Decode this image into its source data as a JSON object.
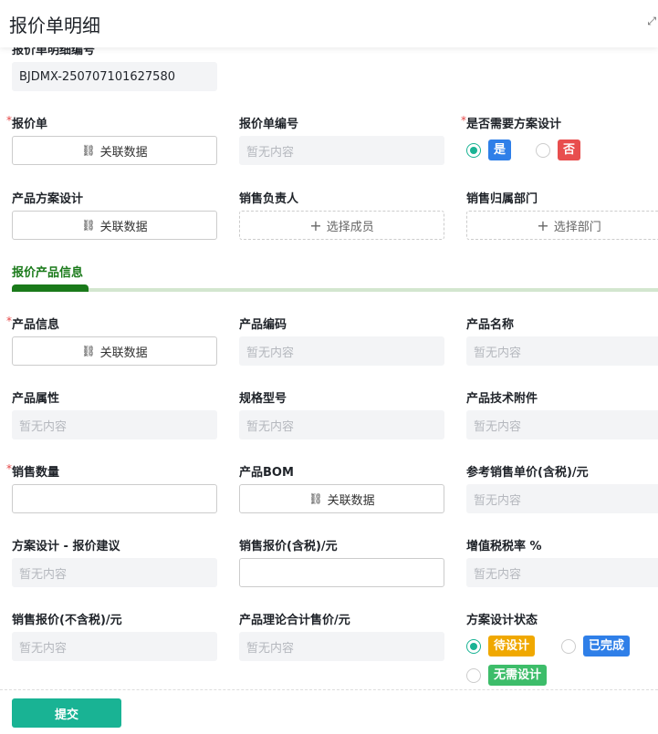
{
  "header": {
    "title": "报价单明细",
    "expand_icon": "expand-icon"
  },
  "detail_no": {
    "label": "报价单明细编号",
    "value": "BJDMX-250707101627580"
  },
  "placeholders": {
    "empty": "暂无内容",
    "link": "关联数据",
    "member": "选择成员",
    "dept": "选择部门"
  },
  "section_title": "报价产品信息",
  "fields": [
    {
      "label": "报价单",
      "required": true,
      "kind": "link"
    },
    {
      "label": "报价单编号",
      "kind": "ro"
    },
    {
      "label": "是否需要方案设计",
      "required": true,
      "kind": "radio"
    },
    {
      "label": "产品方案设计",
      "kind": "link"
    },
    {
      "label": "销售负责人",
      "kind": "member"
    },
    {
      "label": "销售归属部门",
      "kind": "dept"
    },
    {
      "label": "产品信息",
      "required": true,
      "kind": "link"
    },
    {
      "label": "产品编码",
      "kind": "ro"
    },
    {
      "label": "产品名称",
      "kind": "ro"
    },
    {
      "label": "产品属性",
      "kind": "ro"
    },
    {
      "label": "规格型号",
      "kind": "ro"
    },
    {
      "label": "产品技术附件",
      "kind": "ro"
    },
    {
      "label": "销售数量",
      "required": true,
      "kind": "input"
    },
    {
      "label": "产品BOM",
      "kind": "link"
    },
    {
      "label": "参考销售单价(含税)/元",
      "kind": "ro"
    },
    {
      "label": "方案设计 - 报价建议",
      "kind": "ro"
    },
    {
      "label": "销售报价(含税)/元",
      "kind": "input"
    },
    {
      "label": "增值税税率 %",
      "kind": "ro"
    },
    {
      "label": "销售报价(不含税)/元",
      "kind": "ro"
    },
    {
      "label": "产品理论合计售价/元",
      "kind": "ro"
    },
    {
      "label": "方案设计状态",
      "kind": "radio2"
    }
  ],
  "need_design_options": [
    {
      "label": "是",
      "color": "#2f7fe8",
      "selected": true
    },
    {
      "label": "否",
      "color": "#e84e4e",
      "selected": false
    }
  ],
  "design_status_options": [
    {
      "label": "待设计",
      "color": "#f0a800",
      "selected": true
    },
    {
      "label": "已完成",
      "color": "#2f7fe8",
      "selected": false
    },
    {
      "label": "无需设计",
      "color": "#3dbd6a",
      "selected": false
    }
  ],
  "submit_label": "提交"
}
